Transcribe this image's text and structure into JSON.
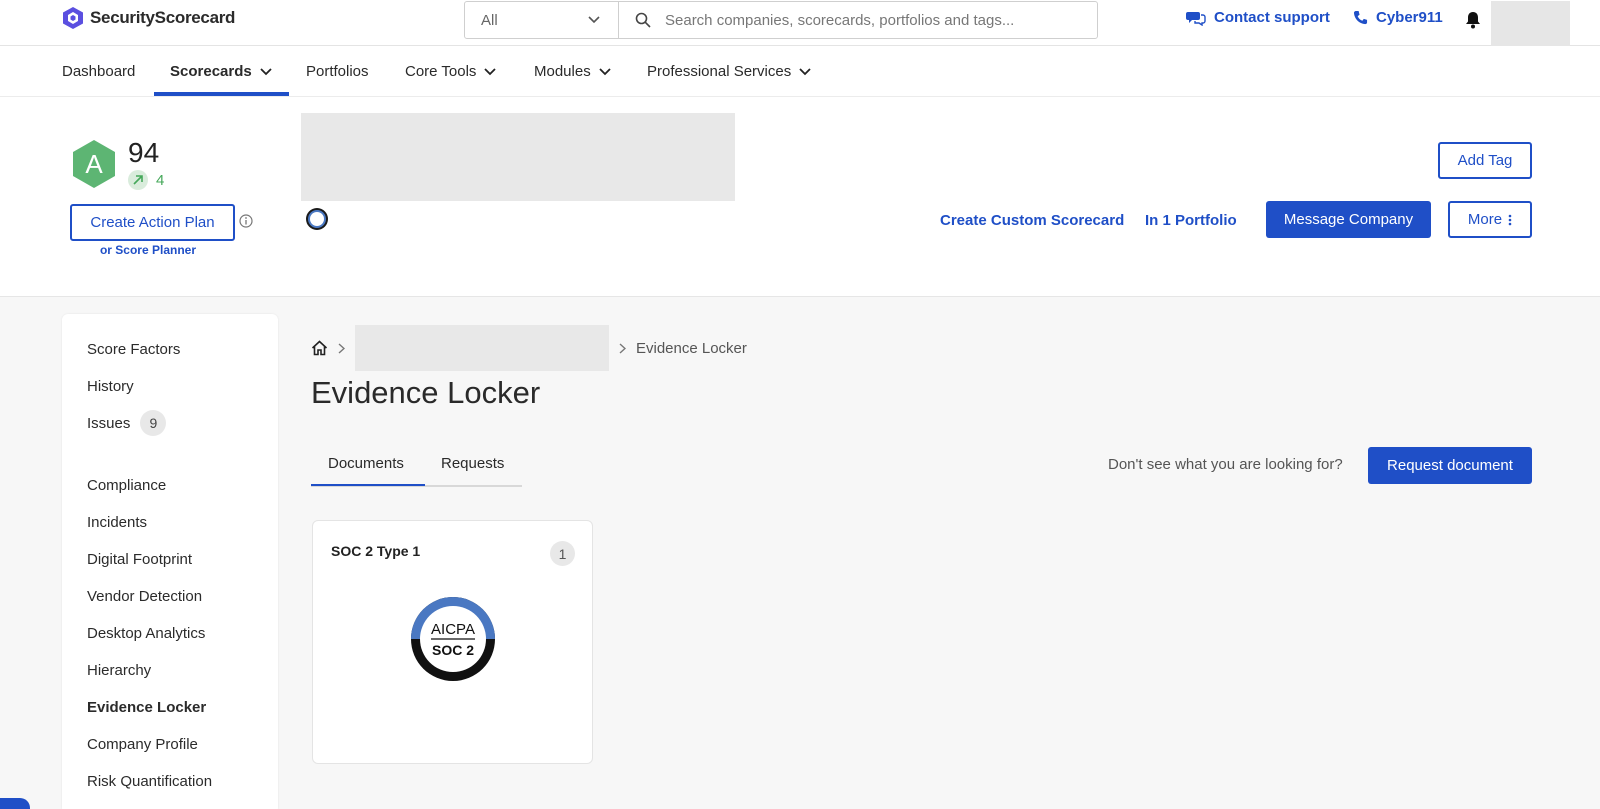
{
  "app": {
    "brand": "SecurityScorecard",
    "colors": {
      "accent": "#1f4fc7",
      "grade_green": "#5db573",
      "delta_green": "#45a85a"
    }
  },
  "topbar": {
    "scope_value": "All",
    "search_placeholder": "Search companies, scorecards, portfolios and tags...",
    "contact_support": "Contact support",
    "cyber911": "Cyber911",
    "icons": [
      "logo-icon",
      "chevron-down-icon",
      "search-icon",
      "chat-icon",
      "phone-icon",
      "bell-icon"
    ]
  },
  "nav": {
    "items": [
      {
        "label": "Dashboard"
      },
      {
        "label": "Scorecards",
        "active": true
      },
      {
        "label": "Portfolios"
      },
      {
        "label": "Core Tools"
      },
      {
        "label": "Modules"
      },
      {
        "label": "Professional Services"
      }
    ]
  },
  "header": {
    "grade": "A",
    "score": "94",
    "score_change": "4",
    "create_action_plan": "Create Action Plan",
    "score_planner": "or Score Planner",
    "add_tag": "Add Tag",
    "create_custom_scorecard": "Create Custom Scorecard",
    "portfolio_link": "In 1 Portfolio",
    "message_company": "Message Company",
    "more": "More"
  },
  "sidebar": {
    "items": [
      {
        "label": "Score Factors"
      },
      {
        "label": "History"
      },
      {
        "label": "Issues",
        "count": "9"
      },
      {
        "label": "Compliance"
      },
      {
        "label": "Incidents"
      },
      {
        "label": "Digital Footprint"
      },
      {
        "label": "Vendor Detection"
      },
      {
        "label": "Desktop Analytics"
      },
      {
        "label": "Hierarchy"
      },
      {
        "label": "Evidence Locker",
        "active": true
      },
      {
        "label": "Company Profile"
      },
      {
        "label": "Risk Quantification"
      }
    ]
  },
  "main": {
    "breadcrumb_current": "Evidence Locker",
    "title": "Evidence Locker",
    "tabs": [
      {
        "label": "Documents",
        "active": true
      },
      {
        "label": "Requests"
      }
    ],
    "helper_text": "Don't see what you are looking for?",
    "request_document": "Request document",
    "documents": [
      {
        "title": "SOC 2 Type 1",
        "count": "1",
        "logo_top": "AICPA",
        "logo_bottom": "SOC 2"
      }
    ]
  }
}
